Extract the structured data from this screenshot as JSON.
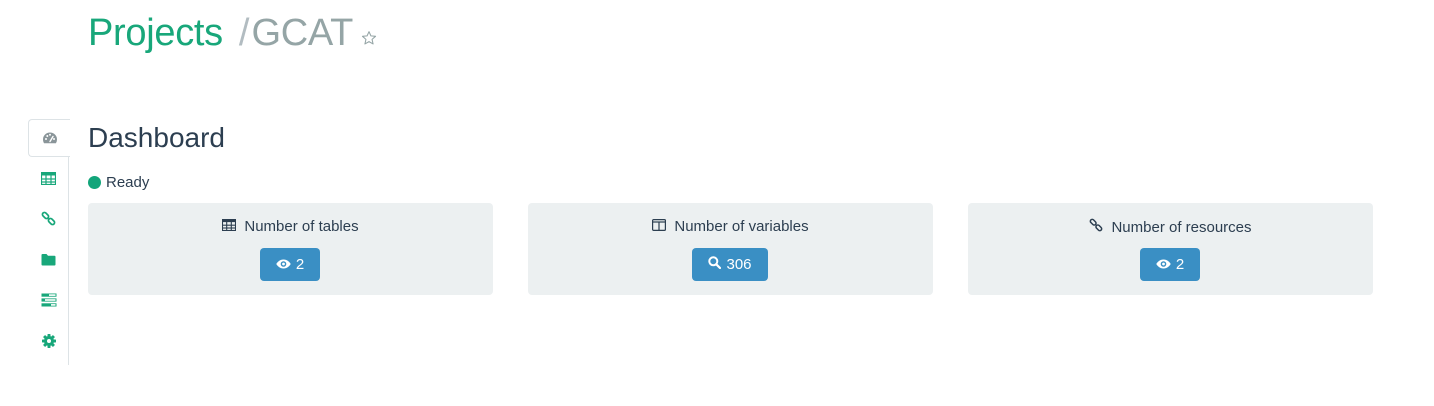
{
  "breadcrumb": {
    "parent": "Projects",
    "separator": "/",
    "current": "GCAT",
    "favorite_icon": "star-outline-icon"
  },
  "sidebar": {
    "items": [
      {
        "icon": "dashboard-icon",
        "active": true
      },
      {
        "icon": "table-icon",
        "active": false
      },
      {
        "icon": "link-icon",
        "active": false
      },
      {
        "icon": "folder-icon",
        "active": false
      },
      {
        "icon": "tasks-icon",
        "active": false
      },
      {
        "icon": "gear-icon",
        "active": false
      }
    ]
  },
  "dashboard": {
    "title": "Dashboard",
    "status": "Ready",
    "status_color": "#12a57a",
    "cards": [
      {
        "label": "Number of tables",
        "icon": "table-icon",
        "button_icon": "eye-icon",
        "value": "2"
      },
      {
        "label": "Number of variables",
        "icon": "columns-icon",
        "button_icon": "search-icon",
        "value": "306"
      },
      {
        "label": "Number of resources",
        "icon": "link-icon",
        "button_icon": "eye-icon",
        "value": "2"
      }
    ]
  },
  "colors": {
    "accent": "#18a77a",
    "button": "#3a8fc4",
    "card_bg": "#ecf0f1",
    "text": "#2c3e50"
  }
}
